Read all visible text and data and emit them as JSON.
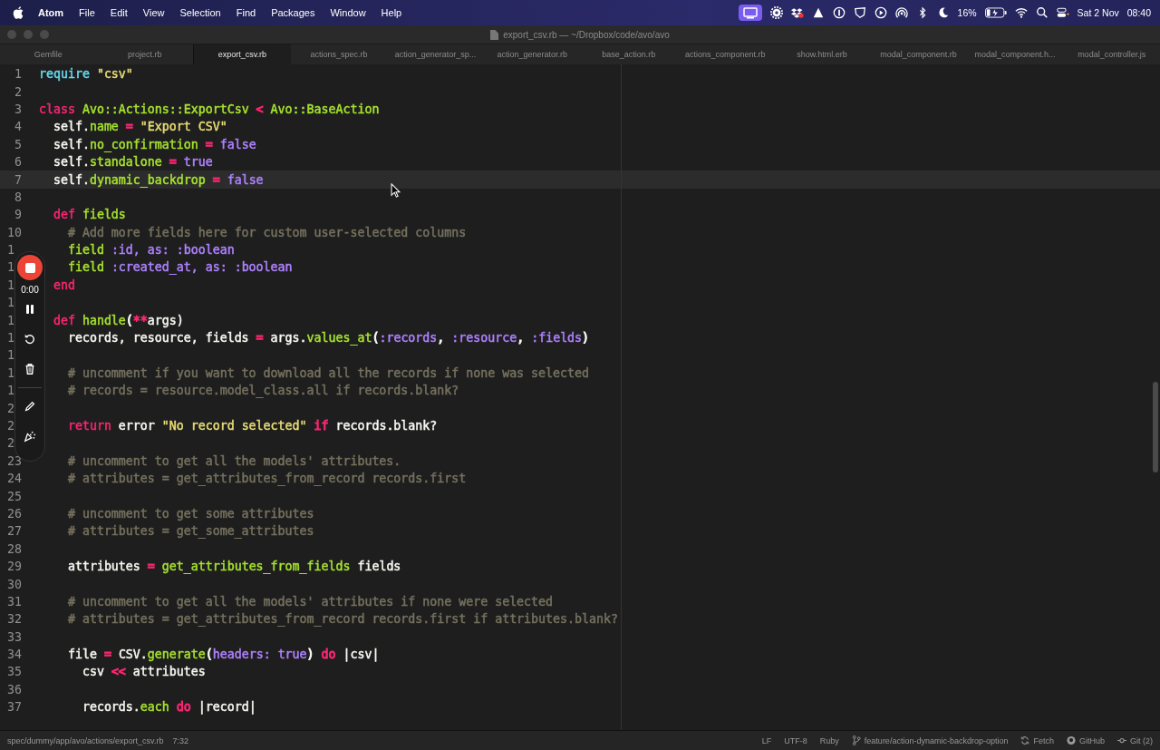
{
  "menu_bar": {
    "app": "Atom",
    "items": [
      "File",
      "Edit",
      "View",
      "Selection",
      "Find",
      "Packages",
      "Window",
      "Help"
    ],
    "battery": "16%",
    "date": "Sat 2 Nov",
    "time": "08:40"
  },
  "window": {
    "title": "export_csv.rb — ~/Dropbox/code/avo/avo"
  },
  "tabs": [
    {
      "label": "Gemfile",
      "selected": false
    },
    {
      "label": "project.rb",
      "selected": false
    },
    {
      "label": "export_csv.rb",
      "selected": true
    },
    {
      "label": "actions_spec.rb",
      "selected": false
    },
    {
      "label": "action_generator_sp...",
      "selected": false
    },
    {
      "label": "action_generator.rb",
      "selected": false
    },
    {
      "label": "base_action.rb",
      "selected": false
    },
    {
      "label": "actions_component.rb",
      "selected": false
    },
    {
      "label": "show.html.erb",
      "selected": false
    },
    {
      "label": "modal_component.rb",
      "selected": false
    },
    {
      "label": "modal_component.h...",
      "selected": false
    },
    {
      "label": "modal_controller.js",
      "selected": false
    }
  ],
  "editor": {
    "lines": [
      {
        "number": "1",
        "cut": false,
        "current": false,
        "tokens": [
          {
            "t": "require",
            "color": "#66d9ef"
          },
          {
            "t": " \"csv\"",
            "color": "#e6db74"
          }
        ]
      },
      {
        "number": "2",
        "cut": false,
        "current": false
      },
      {
        "number": "3",
        "cut": false,
        "current": false,
        "tokens": [
          {
            "t": "class",
            "color": "#f92672"
          },
          {
            "t": " Avo::Actions::ExportCsv ",
            "color": "#a6e22e"
          },
          {
            "t": "<",
            "color": "#f92672"
          },
          {
            "t": " Avo::BaseAction",
            "color": "#a6e22e"
          }
        ]
      },
      {
        "number": "4",
        "cut": false,
        "current": false,
        "tokens": [
          {
            "t": "  self.",
            "color": "#f8f8f2"
          },
          {
            "t": "name",
            "color": "#a6e22e"
          },
          {
            "t": " = ",
            "color": "#f92672"
          },
          {
            "t": "\"Export CSV\"",
            "color": "#e6db74"
          }
        ]
      },
      {
        "number": "5",
        "cut": false,
        "current": false,
        "tokens": [
          {
            "t": "  self.",
            "color": "#f8f8f2"
          },
          {
            "t": "no_confirmation",
            "color": "#a6e22e"
          },
          {
            "t": " = ",
            "color": "#f92672"
          },
          {
            "t": "false",
            "color": "#ae81ff"
          }
        ]
      },
      {
        "number": "6",
        "cut": false,
        "current": false,
        "tokens": [
          {
            "t": "  self.",
            "color": "#f8f8f2"
          },
          {
            "t": "standalone",
            "color": "#a6e22e"
          },
          {
            "t": " = ",
            "color": "#f92672"
          },
          {
            "t": "true",
            "color": "#ae81ff"
          }
        ]
      },
      {
        "number": "7",
        "cut": false,
        "current": true,
        "tokens": [
          {
            "t": "  self.",
            "color": "#f8f8f2"
          },
          {
            "t": "dynamic_backdrop",
            "color": "#a6e22e"
          },
          {
            "t": " = ",
            "color": "#f92672"
          },
          {
            "t": "false",
            "color": "#ae81ff"
          }
        ]
      },
      {
        "number": "8",
        "cut": false,
        "current": false
      },
      {
        "number": "9",
        "cut": false,
        "current": false,
        "tokens": [
          {
            "t": "  def",
            "color": "#f92672"
          },
          {
            "t": " fields",
            "color": "#a6e22e"
          }
        ]
      },
      {
        "number": "10",
        "cut": false,
        "current": false,
        "tokens": [
          {
            "t": "    # Add more fields here for custom user-selected columns",
            "color": "#75715e"
          }
        ]
      },
      {
        "number": "1",
        "cut": true,
        "current": false,
        "tokens": [
          {
            "t": "    field",
            "color": "#a6e22e"
          },
          {
            "t": " :id, as: :boolean",
            "color": "#ae81ff"
          }
        ]
      },
      {
        "number": "1",
        "cut": true,
        "current": false,
        "tokens": [
          {
            "t": "    field",
            "color": "#a6e22e"
          },
          {
            "t": " :created_at, as: :boolean",
            "color": "#ae81ff"
          }
        ]
      },
      {
        "number": "1",
        "cut": true,
        "current": false,
        "tokens": [
          {
            "t": "  end",
            "color": "#f92672"
          }
        ]
      },
      {
        "number": "1",
        "cut": true,
        "current": false
      },
      {
        "number": "1",
        "cut": true,
        "current": false,
        "tokens": [
          {
            "t": "  def",
            "color": "#f92672"
          },
          {
            "t": " handle",
            "color": "#a6e22e"
          },
          {
            "t": "(",
            "color": "#f8f8f2"
          },
          {
            "t": "**",
            "color": "#f92672"
          },
          {
            "t": "args)",
            "color": "#f8f8f2"
          }
        ]
      },
      {
        "number": "1",
        "cut": true,
        "current": false,
        "tokens": [
          {
            "t": "    records, resource, fields ",
            "color": "#f8f8f2"
          },
          {
            "t": "=",
            "color": "#f92672"
          },
          {
            "t": " args.",
            "color": "#f8f8f2"
          },
          {
            "t": "values_at",
            "color": "#a6e22e"
          },
          {
            "t": "(",
            "color": "#f8f8f2"
          },
          {
            "t": ":records",
            "color": "#ae81ff"
          },
          {
            "t": ", ",
            "color": "#f8f8f2"
          },
          {
            "t": ":resource",
            "color": "#ae81ff"
          },
          {
            "t": ",",
            "color": "#f8f8f2"
          },
          {
            "t": " :fields",
            "color": "#ae81ff"
          },
          {
            "t": ")",
            "color": "#f8f8f2"
          }
        ]
      },
      {
        "number": "1",
        "cut": true,
        "current": false
      },
      {
        "number": "1",
        "cut": true,
        "current": false,
        "tokens": [
          {
            "t": "    # uncomment if you want to download all the records if none was selected",
            "color": "#75715e"
          }
        ]
      },
      {
        "number": "1",
        "cut": true,
        "current": false,
        "tokens": [
          {
            "t": "    # records = resource.model_class.all if records.blank?",
            "color": "#75715e"
          }
        ]
      },
      {
        "number": "2",
        "cut": true,
        "current": false
      },
      {
        "number": "2",
        "cut": true,
        "current": false,
        "tokens": [
          {
            "t": "    return",
            "color": "#f92672"
          },
          {
            "t": " error ",
            "color": "#f8f8f2"
          },
          {
            "t": "\"No record selected\"",
            "color": "#e6db74"
          },
          {
            "t": " if",
            "color": "#f92672"
          },
          {
            "t": " records.blank?",
            "color": "#f8f8f2"
          }
        ]
      },
      {
        "number": "2",
        "cut": true,
        "current": false
      },
      {
        "number": "23",
        "cut": false,
        "current": false,
        "tokens": [
          {
            "t": "    # uncomment to get all the models' attributes.",
            "color": "#75715e"
          }
        ]
      },
      {
        "number": "24",
        "cut": false,
        "current": false,
        "tokens": [
          {
            "t": "    # attributes = get_attributes_from_record records.first",
            "color": "#75715e"
          }
        ]
      },
      {
        "number": "25",
        "cut": false,
        "current": false
      },
      {
        "number": "26",
        "cut": false,
        "current": false,
        "tokens": [
          {
            "t": "    # uncomment to get some attributes",
            "color": "#75715e"
          }
        ]
      },
      {
        "number": "27",
        "cut": false,
        "current": false,
        "tokens": [
          {
            "t": "    # attributes = get_some_attributes",
            "color": "#75715e"
          }
        ]
      },
      {
        "number": "28",
        "cut": false,
        "current": false
      },
      {
        "number": "29",
        "cut": false,
        "current": false,
        "tokens": [
          {
            "t": "    attributes ",
            "color": "#f8f8f2"
          },
          {
            "t": "=",
            "color": "#f92672"
          },
          {
            "t": " get_attributes_from_fields",
            "color": "#a6e22e"
          },
          {
            "t": " fields",
            "color": "#f8f8f2"
          }
        ]
      },
      {
        "number": "30",
        "cut": false,
        "current": false
      },
      {
        "number": "31",
        "cut": false,
        "current": false,
        "tokens": [
          {
            "t": "    # uncomment to get all the models' attributes if none were selected",
            "color": "#75715e"
          }
        ]
      },
      {
        "number": "32",
        "cut": false,
        "current": false,
        "tokens": [
          {
            "t": "    # attributes = get_attributes_from_record records.first if attributes.blank?",
            "color": "#75715e"
          }
        ]
      },
      {
        "number": "33",
        "cut": false,
        "current": false
      },
      {
        "number": "34",
        "cut": false,
        "current": false,
        "tokens": [
          {
            "t": "    file ",
            "color": "#f8f8f2"
          },
          {
            "t": "=",
            "color": "#f92672"
          },
          {
            "t": " CSV.",
            "color": "#f8f8f2"
          },
          {
            "t": "generate",
            "color": "#a6e22e"
          },
          {
            "t": "(",
            "color": "#f8f8f2"
          },
          {
            "t": "headers:",
            "color": "#ae81ff"
          },
          {
            "t": " true",
            "color": "#ae81ff"
          },
          {
            "t": ") ",
            "color": "#f8f8f2"
          },
          {
            "t": "do",
            "color": "#f92672"
          },
          {
            "t": " |csv|",
            "color": "#f8f8f2"
          }
        ]
      },
      {
        "number": "35",
        "cut": false,
        "current": false,
        "tokens": [
          {
            "t": "      csv ",
            "color": "#f8f8f2"
          },
          {
            "t": "<<",
            "color": "#f92672"
          },
          {
            "t": " attributes",
            "color": "#f8f8f2"
          }
        ]
      },
      {
        "number": "36",
        "cut": false,
        "current": false
      },
      {
        "number": "37",
        "cut": false,
        "current": false,
        "tokens": [
          {
            "t": "      records.",
            "color": "#f8f8f2"
          },
          {
            "t": "each",
            "color": "#a6e22e"
          },
          {
            "t": " do",
            "color": "#f92672"
          },
          {
            "t": " |record|",
            "color": "#f8f8f2"
          }
        ]
      }
    ]
  },
  "recorder": {
    "time": "0:00"
  },
  "status_bar": {
    "path": "spec/dummy/app/avo/actions/export_csv.rb",
    "cursor": "7:32",
    "line_ending": "LF",
    "encoding": "UTF-8",
    "grammar": "Ruby",
    "branch": "feature/action-dynamic-backdrop-option",
    "fetch": "Fetch",
    "github": "GitHub",
    "git": "Git (2)"
  }
}
